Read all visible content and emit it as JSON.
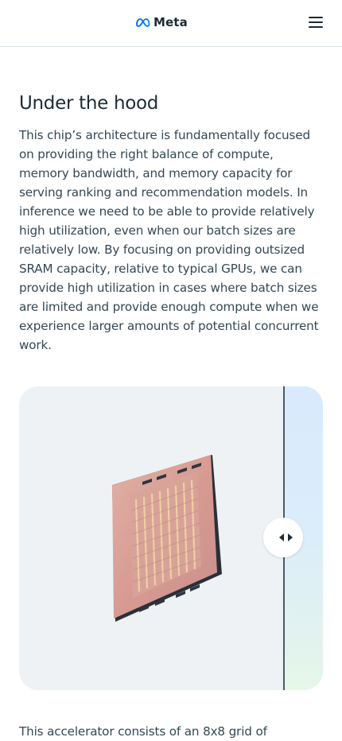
{
  "header": {
    "brand": "Meta",
    "menu_icon": "hamburger-menu-icon"
  },
  "section": {
    "title": "Under the hood",
    "paragraph": "This chip’s architecture is fundamentally focused on providing the right balance of compute, memory bandwidth, and memory capacity for serving ranking and recommendation models. In inference we need to be able to provide relatively high utilization, even when our batch sizes are relatively low. By focusing on providing outsized SRAM capacity, relative to typical GPUs, we can provide high utilization in cases where batch sizes are limited and provide enough compute when we experience larger amounts of potential concurrent work."
  },
  "comparison": {
    "image_subject": "chip-image",
    "handle_icon": "left-right-arrows-icon",
    "slider_position": 0.87
  },
  "next_paragraph": "This accelerator consists of an 8x8 grid of",
  "colors": {
    "text_primary": "#1c2b33",
    "text_body": "#344854",
    "media_background": "#eef2f5",
    "divider": "#4b5a63"
  }
}
